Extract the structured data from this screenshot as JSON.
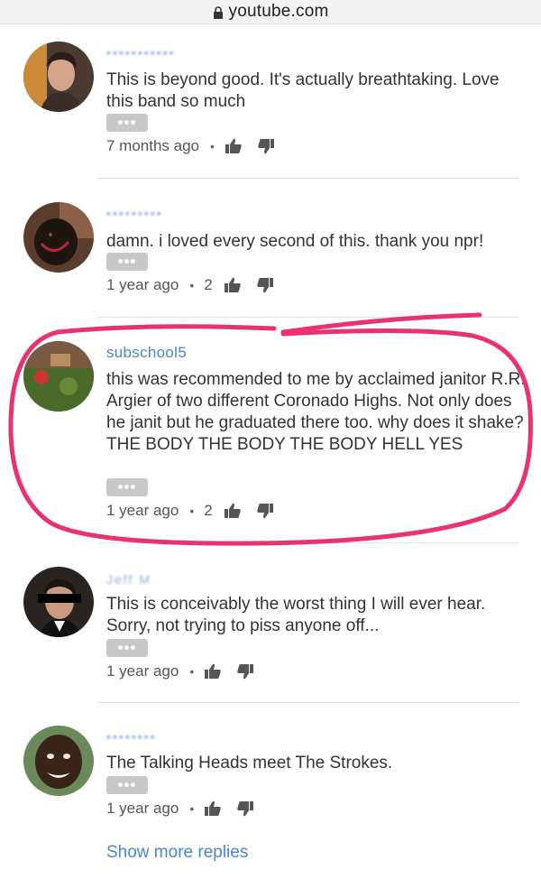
{
  "browser": {
    "url": "youtube.com"
  },
  "comments": [
    {
      "author": "",
      "author_blurred": true,
      "text": "This is beyond good. It's actually breathtaking. Love this band so much",
      "time": "7 months ago",
      "likes": "",
      "more_label": "•••"
    },
    {
      "author": "",
      "author_blurred": true,
      "text": "damn. i loved every second of this. thank you npr!",
      "time": "1 year ago",
      "likes": "2",
      "more_label": "•••"
    },
    {
      "author": "subschool5",
      "author_blurred": false,
      "text": "this was recommended to me by acclaimed janitor R.R. Argier of two different Coronado Highs. Not only does he janit but he graduated there too. why does it shake? THE BODY THE BODY THE BODY HELL YES",
      "time": "1 year ago",
      "likes": "2",
      "more_label": "•••",
      "highlighted": true,
      "highlight_color": "#e8336f"
    },
    {
      "author": "Jeff M",
      "author_blurred": true,
      "text": "This is conceivably the worst thing I will ever hear. Sorry, not trying to piss anyone off...",
      "time": "1 year ago",
      "likes": "",
      "more_label": "•••"
    },
    {
      "author": "",
      "author_blurred": true,
      "text": "The Talking Heads meet The Strokes.",
      "time": "1 year ago",
      "likes": "",
      "more_label": "•••"
    }
  ],
  "show_more_label": "Show more replies",
  "colors": {
    "link": "#4a86c8",
    "highlight": "#e8336f",
    "more_button": "#c8c8c8"
  },
  "icons": [
    "lock-icon",
    "thumbs-up-icon",
    "thumbs-down-icon",
    "more-options-icon"
  ]
}
